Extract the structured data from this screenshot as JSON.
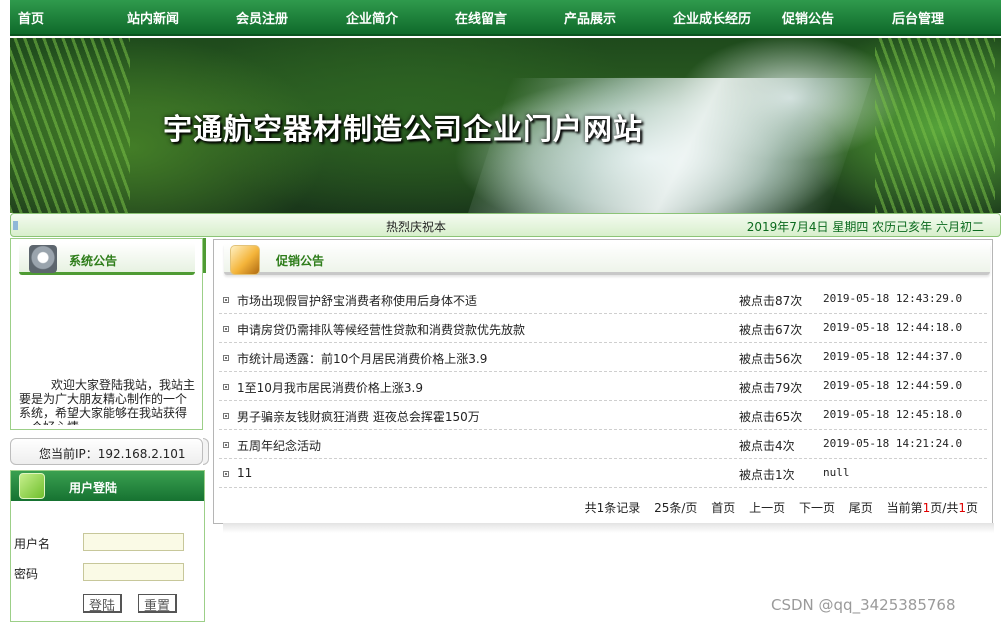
{
  "nav": {
    "items": [
      "首页",
      "站内新闻",
      "会员注册",
      "企业简介",
      "在线留言",
      "产品展示",
      "企业成长经历",
      "促销公告",
      "后台管理"
    ]
  },
  "banner": {
    "title": "宇通航空器材制造公司企业门户网站"
  },
  "ticker": {
    "text": "热烈庆祝本",
    "date": "2019年7月4日  星期四  农历己亥年  六月初二"
  },
  "system_notice": {
    "title": "系统公告",
    "text": "欢迎大家登陆我站，我站主要是为广大朋友精心制作的一个系统，希望大家能够在我站获得一个好心情"
  },
  "ip": {
    "text": "您当前IP：192.168.2.101"
  },
  "login": {
    "title": "用户登陆",
    "username_label": "用户名",
    "password_label": "密码",
    "login_button": "登陆",
    "reset_button": "重置"
  },
  "promotions": {
    "title": "促销公告",
    "rows": [
      {
        "title": "市场出现假冒护舒宝消费者称使用后身体不适",
        "clicks": "被点击87次",
        "time": "2019-05-18 12:43:29.0"
      },
      {
        "title": "申请房贷仍需排队等候经营性贷款和消费贷款优先放款",
        "clicks": "被点击67次",
        "time": "2019-05-18 12:44:18.0"
      },
      {
        "title": "市统计局透露：前10个月居民消费价格上涨3.9",
        "clicks": "被点击56次",
        "time": "2019-05-18 12:44:37.0"
      },
      {
        "title": "1至10月我市居民消费价格上涨3.9",
        "clicks": "被点击79次",
        "time": "2019-05-18 12:44:59.0"
      },
      {
        "title": "男子骗亲友钱财疯狂消费 逛夜总会挥霍150万",
        "clicks": "被点击65次",
        "time": "2019-05-18 12:45:18.0"
      },
      {
        "title": "五周年纪念活动",
        "clicks": "被点击4次",
        "time": "2019-05-18 14:21:24.0"
      },
      {
        "title": "11",
        "clicks": "被点击1次",
        "time": "null"
      }
    ]
  },
  "pager": {
    "total": "共1条记录",
    "per_page": "25条/页",
    "first": "首页",
    "prev": "上一页",
    "next": "下一页",
    "last": "尾页",
    "current_prefix": "当前第",
    "current_page": "1",
    "current_mid": "页/共",
    "total_pages": "1",
    "current_suffix": "页"
  },
  "watermark": {
    "text": "CSDN @qq_3425385768"
  }
}
